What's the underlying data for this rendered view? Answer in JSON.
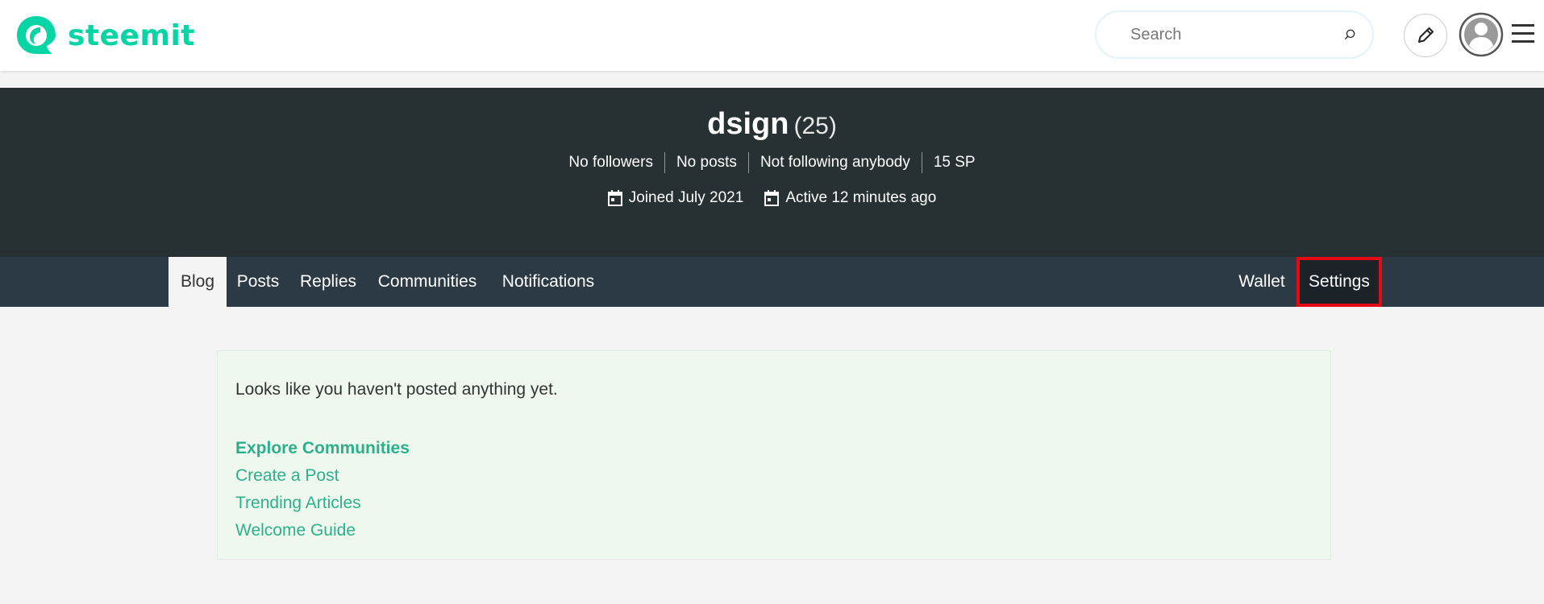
{
  "header": {
    "logo_text": "steemit",
    "brand_color": "#07d5a6",
    "search_placeholder": "Search",
    "icons": [
      "search-icon",
      "pencil-icon",
      "user-avatar-icon",
      "hamburger-menu-icon"
    ]
  },
  "profile": {
    "name": "dsign",
    "reputation": "(25)",
    "stats": [
      "No followers",
      "No posts",
      "Not following anybody",
      "15 SP"
    ],
    "joined": "Joined July 2021",
    "active": "Active 12 minutes ago",
    "hero_color": "#273032"
  },
  "tabs": {
    "left": [
      "Blog",
      "Posts",
      "Replies",
      "Communities",
      "Notifications"
    ],
    "right": [
      "Wallet",
      "Settings"
    ],
    "active": "Blog",
    "highlighted": "Settings",
    "highlight_color": "#e50914"
  },
  "empty_state": {
    "message": "Looks like you haven't posted anything yet.",
    "links": [
      "Explore Communities",
      "Create a Post",
      "Trending Articles",
      "Welcome Guide"
    ],
    "link_color": "#2db08a"
  }
}
